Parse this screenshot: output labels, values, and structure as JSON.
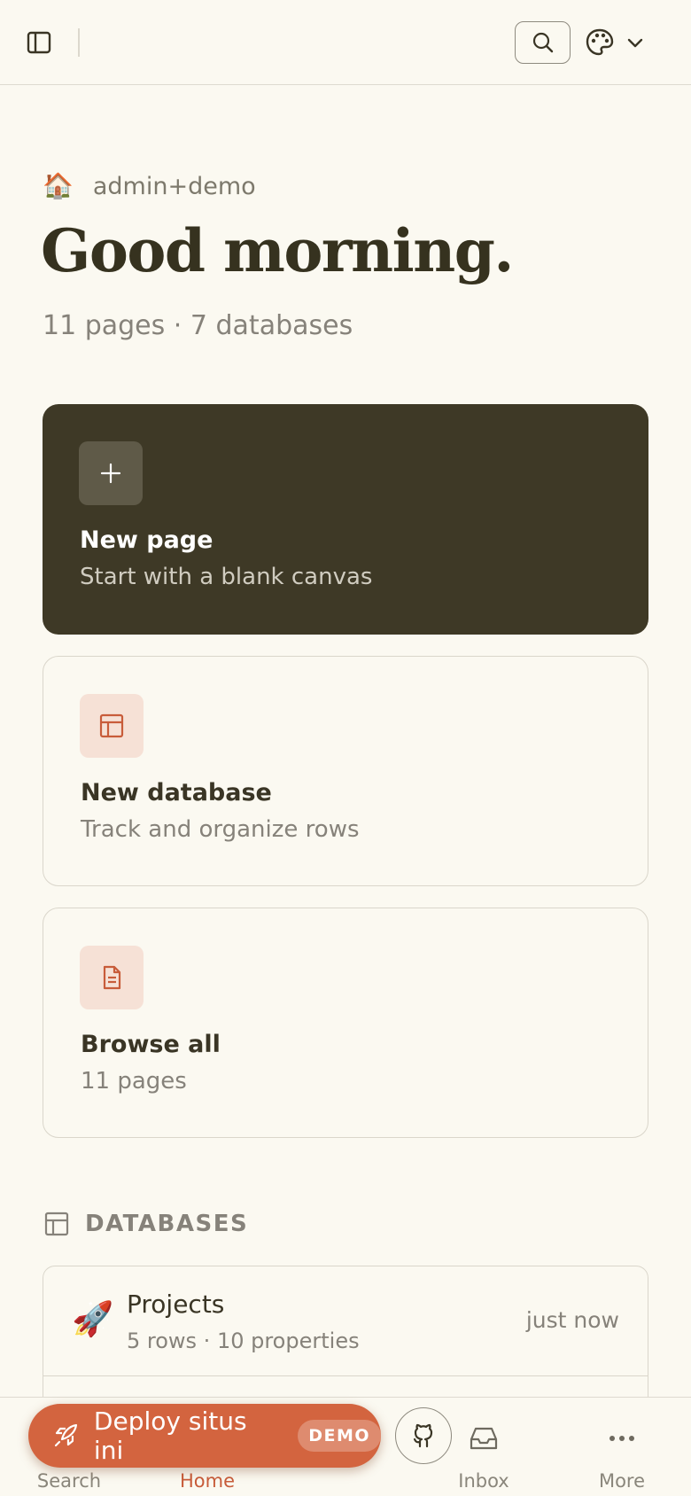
{
  "header": {
    "sidebar_toggle_icon": "sidebar-icon",
    "search_icon": "search-icon",
    "theme_icon": "palette-icon",
    "theme_chevron_icon": "chevron-down-icon"
  },
  "workspace": {
    "icon": "🏠",
    "name": "admin+demo"
  },
  "greeting": "Good morning.",
  "stats": "11 pages · 7 databases",
  "cards": {
    "new_page": {
      "title": "New page",
      "subtitle": "Start with a blank canvas",
      "icon": "plus-icon"
    },
    "new_database": {
      "title": "New database",
      "subtitle": "Track and organize rows",
      "icon": "table-icon"
    },
    "browse_all": {
      "title": "Browse all",
      "subtitle": "11 pages",
      "icon": "document-icon"
    }
  },
  "databases": {
    "heading": "DATABASES",
    "items": [
      {
        "emoji": "🚀",
        "name": "Projects",
        "meta": "5 rows · 10 properties",
        "updated": "just now"
      }
    ]
  },
  "deploy": {
    "label": "Deploy situs ini",
    "badge": "DEMO",
    "icon": "rocket-icon"
  },
  "nav": {
    "items": [
      {
        "label": "Search",
        "icon": "search-icon"
      },
      {
        "label": "Home",
        "icon": "home-icon",
        "active": true
      },
      {
        "label": "Inbox",
        "icon": "inbox-icon"
      },
      {
        "label": "More",
        "icon": "more-icon"
      }
    ],
    "github_icon": "github-icon"
  },
  "colors": {
    "background": "#fbf9f1",
    "accent": "#d3643f",
    "dark_card": "#3e3926",
    "active_nav": "#c85c3a"
  }
}
